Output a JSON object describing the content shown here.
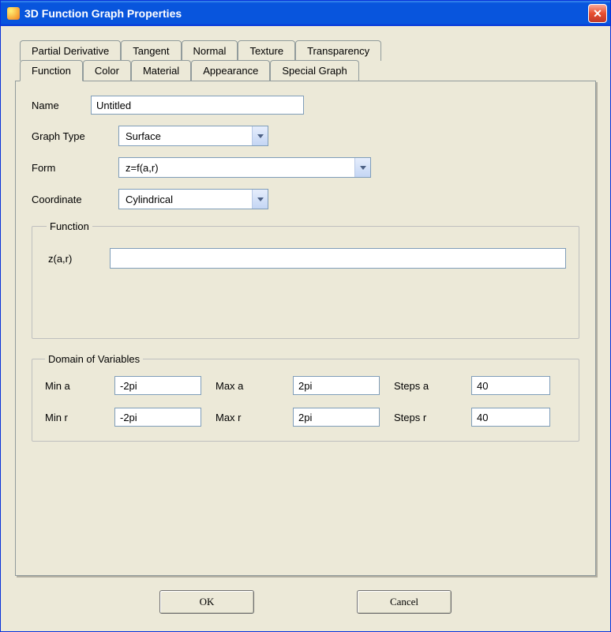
{
  "title": "3D Function Graph Properties",
  "tabs_row1": [
    "Partial Derivative",
    "Tangent",
    "Normal",
    "Texture",
    "Transparency"
  ],
  "tabs_row2": [
    "Function",
    "Color",
    "Material",
    "Appearance",
    "Special Graph"
  ],
  "active_tab": "Function",
  "labels": {
    "name": "Name",
    "graph_type": "Graph Type",
    "form": "Form",
    "coordinate": "Coordinate",
    "function_group": "Function",
    "zlabel": "z(a,r)",
    "domain_group": "Domain of Variables",
    "min_a": "Min a",
    "max_a": "Max a",
    "steps_a": "Steps a",
    "min_r": "Min r",
    "max_r": "Max r",
    "steps_r": "Steps r"
  },
  "values": {
    "name": "Untitled",
    "graph_type": "Surface",
    "form": "z=f(a,r)",
    "coordinate": "Cylindrical",
    "z_expr": "",
    "min_a": "-2pi",
    "max_a": "2pi",
    "steps_a": "40",
    "min_r": "-2pi",
    "max_r": "2pi",
    "steps_r": "40"
  },
  "buttons": {
    "ok": "OK",
    "cancel": "Cancel"
  }
}
